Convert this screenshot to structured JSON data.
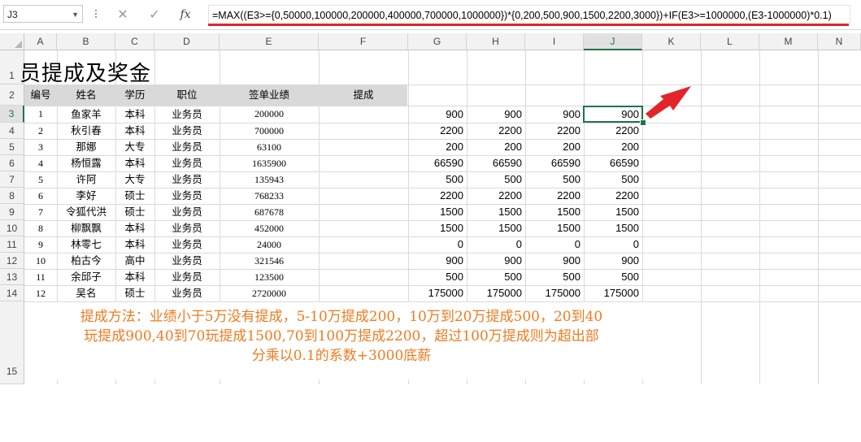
{
  "formula_bar": {
    "name_box": "J3",
    "cancel_glyph": "✕",
    "confirm_glyph": "✓",
    "fx_label": "fx",
    "formula": "=MAX((E3>={0,50000,100000,200000,400000,700000,1000000})*{0,200,500,900,1500,2200,3000})+IF(E3>=1000000,(E3-1000000)*0.1)"
  },
  "columns": [
    "A",
    "B",
    "C",
    "D",
    "E",
    "F",
    "G",
    "H",
    "I",
    "J",
    "K",
    "L",
    "M",
    "N"
  ],
  "rows": [
    "1",
    "2",
    "3",
    "4",
    "5",
    "6",
    "7",
    "8",
    "9",
    "10",
    "11",
    "12",
    "13",
    "14",
    "15"
  ],
  "selected": {
    "col": "J",
    "row": "3"
  },
  "title": "员提成及奖金",
  "headers": [
    "编号",
    "姓名",
    "学历",
    "职位",
    "签单业绩",
    "提成"
  ],
  "data_rows": [
    {
      "no": "1",
      "name": "鱼家羊",
      "edu": "本科",
      "pos": "业务员",
      "sales": "200000",
      "g": "900",
      "h": "900",
      "i": "900",
      "j": "900"
    },
    {
      "no": "2",
      "name": "秋引春",
      "edu": "本科",
      "pos": "业务员",
      "sales": "700000",
      "g": "2200",
      "h": "2200",
      "i": "2200",
      "j": "2200"
    },
    {
      "no": "3",
      "name": "那娜",
      "edu": "大专",
      "pos": "业务员",
      "sales": "63100",
      "g": "200",
      "h": "200",
      "i": "200",
      "j": "200"
    },
    {
      "no": "4",
      "name": "杨恒露",
      "edu": "本科",
      "pos": "业务员",
      "sales": "1635900",
      "g": "66590",
      "h": "66590",
      "i": "66590",
      "j": "66590"
    },
    {
      "no": "5",
      "name": "许阿",
      "edu": "大专",
      "pos": "业务员",
      "sales": "135943",
      "g": "500",
      "h": "500",
      "i": "500",
      "j": "500"
    },
    {
      "no": "6",
      "name": "李好",
      "edu": "硕士",
      "pos": "业务员",
      "sales": "768233",
      "g": "2200",
      "h": "2200",
      "i": "2200",
      "j": "2200"
    },
    {
      "no": "7",
      "name": "令狐代洪",
      "edu": "硕士",
      "pos": "业务员",
      "sales": "687678",
      "g": "1500",
      "h": "1500",
      "i": "1500",
      "j": "1500"
    },
    {
      "no": "8",
      "name": "柳飘飘",
      "edu": "本科",
      "pos": "业务员",
      "sales": "452000",
      "g": "1500",
      "h": "1500",
      "i": "1500",
      "j": "1500"
    },
    {
      "no": "9",
      "name": "林零七",
      "edu": "本科",
      "pos": "业务员",
      "sales": "24000",
      "g": "0",
      "h": "0",
      "i": "0",
      "j": "0"
    },
    {
      "no": "10",
      "name": "柏古今",
      "edu": "高中",
      "pos": "业务员",
      "sales": "321546",
      "g": "900",
      "h": "900",
      "i": "900",
      "j": "900"
    },
    {
      "no": "11",
      "name": "余邱子",
      "edu": "本科",
      "pos": "业务员",
      "sales": "123500",
      "g": "500",
      "h": "500",
      "i": "500",
      "j": "500"
    },
    {
      "no": "12",
      "name": "吴名",
      "edu": "硕士",
      "pos": "业务员",
      "sales": "2720000",
      "g": "175000",
      "h": "175000",
      "i": "175000",
      "j": "175000"
    }
  ],
  "note_lines": [
    "提成方法：业绩小于5万没有提成，5-10万提成200，10万到20万提成500，20到40",
    "玩提成900,40到70玩提成1500,70到100万提成2200，超过100万提成则为超出部",
    "分乘以0.1的系数+3000底薪"
  ],
  "colors": {
    "accent_green": "#217346",
    "annotation_red": "#e3242b",
    "note_orange": "#f07b1f",
    "header_fill": "#d9d9d9"
  },
  "icons": {
    "arrow": "red-arrow-icon"
  }
}
